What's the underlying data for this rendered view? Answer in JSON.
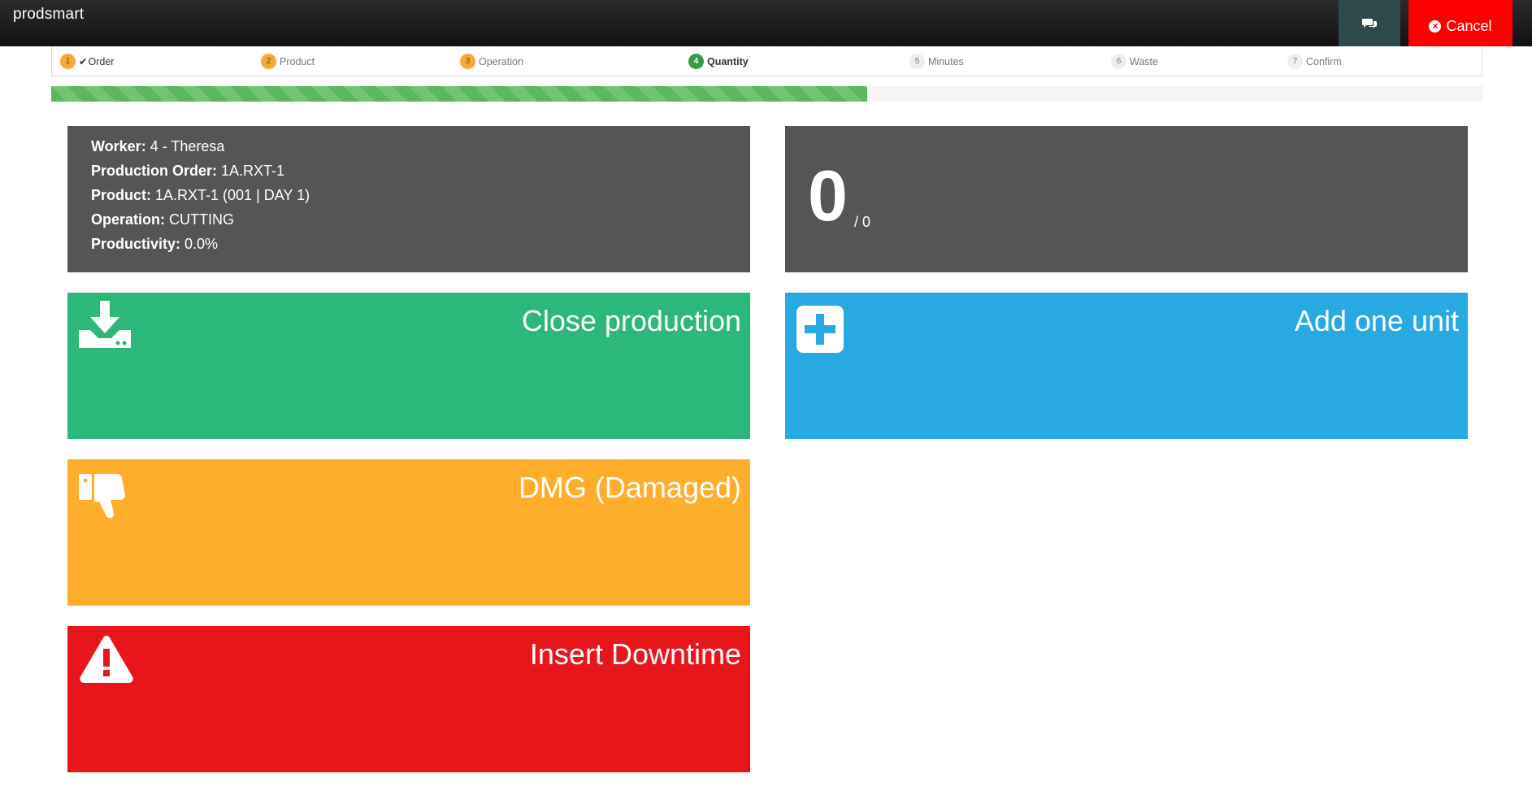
{
  "app": {
    "brand": "prodsmart"
  },
  "header": {
    "cancel_label": "Cancel",
    "chat_icon": "comments-icon"
  },
  "steps": [
    {
      "num": "1",
      "label": "Order",
      "state": "done",
      "check": "✔"
    },
    {
      "num": "2",
      "label": "Product",
      "state": "done"
    },
    {
      "num": "3",
      "label": "Operation",
      "state": "done"
    },
    {
      "num": "4",
      "label": "Quantity",
      "state": "active"
    },
    {
      "num": "5",
      "label": "Minutes",
      "state": "todo"
    },
    {
      "num": "6",
      "label": "Waste",
      "state": "todo"
    },
    {
      "num": "7",
      "label": "Confirm",
      "state": "todo"
    }
  ],
  "progress": {
    "percent": 57
  },
  "info": {
    "worker_label": "Worker:",
    "worker_value": "4 - Theresa",
    "order_label": "Production Order:",
    "order_value": "1A.RXT-1",
    "product_label": "Product:",
    "product_value": "1A.RXT-1 (001 | DAY 1)",
    "operation_label": "Operation:",
    "operation_value": "CUTTING",
    "productivity_label": "Productivity:",
    "productivity_value": "0.0%"
  },
  "counter": {
    "current": "0",
    "total": "/ 0"
  },
  "tiles": {
    "close": {
      "label": "Close production",
      "icon": "download-icon",
      "color": "#2bb87a"
    },
    "add": {
      "label": "Add one unit",
      "icon": "plus-square-icon",
      "color": "#29a9e1"
    },
    "dmg": {
      "label": "DMG (Damaged)",
      "icon": "thumbs-down-icon",
      "color": "#ffad2c"
    },
    "downtime": {
      "label": "Insert Downtime",
      "icon": "warning-icon",
      "color": "#e8161b"
    }
  }
}
